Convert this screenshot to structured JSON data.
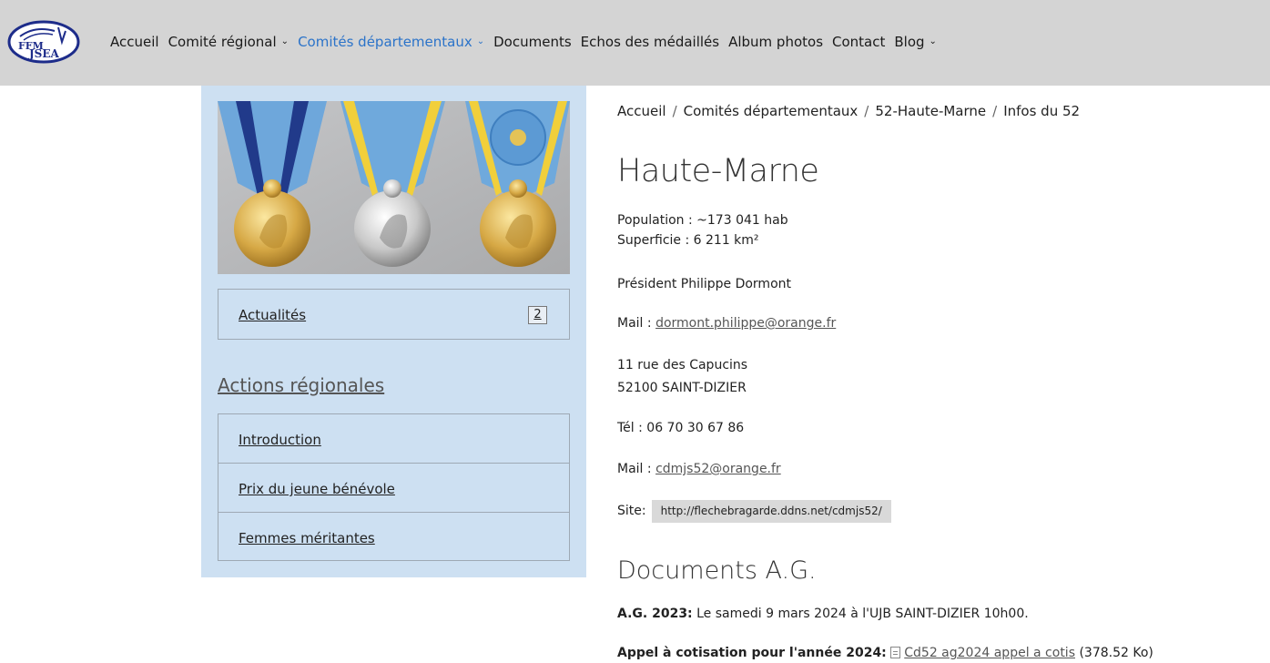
{
  "header": {
    "logo_text": "FFMJSEA",
    "nav": [
      {
        "label": "Accueil",
        "dropdown": false,
        "active": false
      },
      {
        "label": "Comité régional",
        "dropdown": true,
        "active": false
      },
      {
        "label": "Comités départementaux",
        "dropdown": true,
        "active": true
      },
      {
        "label": "Documents",
        "dropdown": false,
        "active": false
      },
      {
        "label": "Echos des médaillés",
        "dropdown": false,
        "active": false
      },
      {
        "label": "Album photos",
        "dropdown": false,
        "active": false
      },
      {
        "label": "Contact",
        "dropdown": false,
        "active": false
      },
      {
        "label": "Blog",
        "dropdown": true,
        "active": false
      }
    ],
    "chevron": "⌄"
  },
  "sidebar": {
    "actualites": {
      "label": "Actualités",
      "count": "2"
    },
    "section_title": "Actions régionales",
    "items": [
      {
        "label": "Introduction"
      },
      {
        "label": "Prix du jeune bénévole"
      },
      {
        "label": "Femmes méritantes"
      }
    ]
  },
  "main": {
    "breadcrumb": [
      "Accueil",
      "Comités départementaux",
      "52-Haute-Marne",
      "Infos du 52"
    ],
    "breadcrumb_sep": "/",
    "title": "Haute-Marne",
    "population": "Population : ~173 041 hab",
    "superficie": "Superficie : 6 211 km²",
    "president": "Président Philippe Dormont",
    "mail1_label": "Mail :",
    "mail1": "dormont.philippe@orange.fr",
    "address1": "11 rue des Capucins",
    "address2": "52100 SAINT-DIZIER",
    "tel": "Tél : 06 70 30 67 86",
    "mail2_label": "Mail :",
    "mail2": "cdmjs52@orange.fr",
    "site_label": "Site:",
    "site_url": "http://flechebragarde.ddns.net/cdmjs52/",
    "docs_title": "Documents A.G.",
    "ag_label": "A.G. 2023:",
    "ag_text": " Le samedi 9 mars 2024 à l'UJB SAINT-DIZIER 10h00.",
    "appel_label": "Appel à cotisation pour l'année 2024:",
    "appel_file": "Cd52 ag2024 appel a cotis",
    "appel_size": " (378.52 Ko)"
  },
  "colors": {
    "topbar": "#d4d4d4",
    "sidebar": "#cde0f2",
    "active_nav": "#2b73c9"
  }
}
